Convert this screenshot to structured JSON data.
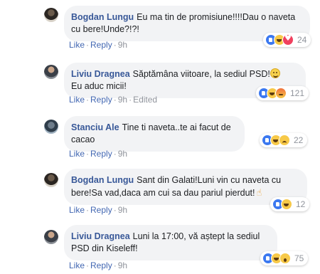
{
  "comments": [
    {
      "author": "Bogdan Lungu",
      "text": "Eu ma tin de promisiune!!!!Dau o naveta cu bere!Unde?!?!",
      "reaction_count": "24",
      "reactions": [
        "like-icon",
        "haha-icon",
        "love-icon"
      ],
      "actions": {
        "like": "Like",
        "reply": "Reply",
        "time": "9h"
      }
    },
    {
      "author": "Liviu Dragnea",
      "verified": true,
      "text": "Săptămâna viitoare, la sediul PSD!",
      "text2": "Eu aduc micii!",
      "reaction_count": "121",
      "reactions": [
        "like-icon",
        "haha-icon",
        "angry-icon"
      ],
      "actions": {
        "like": "Like",
        "reply": "Reply",
        "time": "9h",
        "edited": "Edited"
      }
    },
    {
      "author": "Stanciu Ale",
      "text": "Tine ti naveta..te ai facut de cacao",
      "reaction_count": "22",
      "reactions": [
        "like-icon",
        "haha-icon",
        "sad-icon"
      ],
      "actions": {
        "like": "Like",
        "reply": "Reply",
        "time": "9h"
      }
    },
    {
      "author": "Bogdan Lungu",
      "text": "Sant din Galati!Luni vin cu naveta cu bere!Sa vad,daca am cui sa dau pariul pierdut!",
      "reaction_count": "12",
      "reactions": [
        "like-icon",
        "haha-icon"
      ],
      "actions": {
        "like": "Like",
        "reply": "Reply",
        "time": "9h"
      }
    },
    {
      "author": "Liviu Dragnea",
      "verified": true,
      "text": "Luni la 17:00, vă aștept la sediul PSD din Kiseleff!",
      "reaction_count": "75",
      "reactions": [
        "like-icon",
        "haha-icon",
        "wow-icon"
      ],
      "actions": {
        "like": "Like",
        "reply": "Reply",
        "time": "9h"
      }
    }
  ],
  "colors": {
    "author": "#385898",
    "link": "#4267b2",
    "meta": "#90949c",
    "bubble": "#f2f3f5",
    "verified": "#4267b2"
  }
}
